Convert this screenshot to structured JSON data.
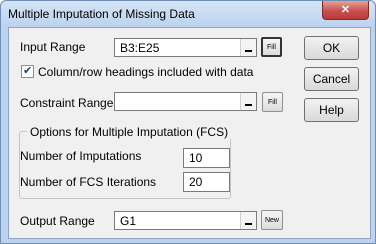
{
  "window": {
    "title": "Multiple Imputation of Missing Data",
    "close_glyph": "✕"
  },
  "input_range": {
    "label": "Input Range",
    "value": "B3:E25",
    "button": "Fill"
  },
  "headings_checkbox": {
    "label": "Column/row headings included with data",
    "checked": true,
    "check_glyph": "✔"
  },
  "constraint_range": {
    "label": "Constraint Range",
    "value": "",
    "button": "Fill"
  },
  "options": {
    "title": "Options for Multiple Imputation (FCS)",
    "imputations_label": "Number of Imputations",
    "imputations_value": "10",
    "iterations_label": "Number of FCS Iterations",
    "iterations_value": "20"
  },
  "output_range": {
    "label": "Output Range",
    "value": "G1",
    "button": "New"
  },
  "buttons": {
    "ok": "OK",
    "cancel": "Cancel",
    "help": "Help"
  },
  "colors": {
    "title_bar": "#bcd2ee",
    "client_bg": "#f0f0f0",
    "close_red": "#c75050"
  }
}
